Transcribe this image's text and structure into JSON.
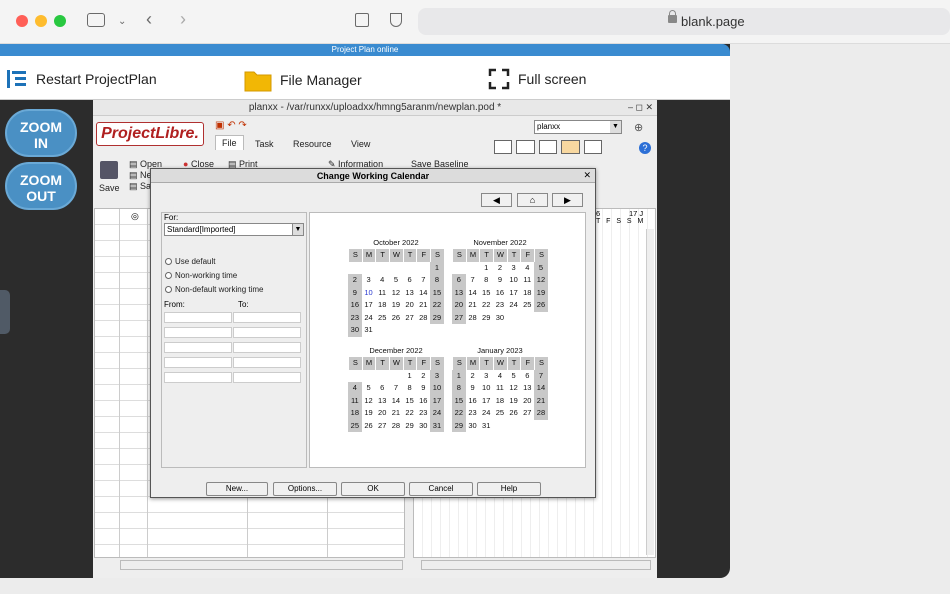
{
  "browser": {
    "url": "blank.page"
  },
  "top_strip": {
    "title": "Project Plan online"
  },
  "toolbar": {
    "restart_label": "Restart ProjectPlan",
    "file_manager_label": "File Manager",
    "full_screen_label": "Full screen"
  },
  "zoom": {
    "in_line1": "ZOOM",
    "in_line2": "IN",
    "out_line1": "ZOOM",
    "out_line2": "OUT"
  },
  "app": {
    "title": "planxx - /var/runxx/uploadxx/hmng5aranm/newplan.pod *",
    "logo": "ProjectLibre.",
    "menu": [
      "File",
      "Task",
      "Resource",
      "View"
    ],
    "project_select": "planxx",
    "ribbon": {
      "save": "Save",
      "open": "Open",
      "close": "Close",
      "print": "Print",
      "information": "Information",
      "save_baseline": "Save Baseline",
      "new_abbr": "Ne",
      "sa_abbr": "Sa"
    },
    "gantt_header": {
      "day_a": "6",
      "day_b": "17 J",
      "letters": "T F S S M"
    }
  },
  "dialog": {
    "title": "Change Working Calendar",
    "for_label": "For:",
    "for_value": "Standard[Imported]",
    "radios": [
      "Use default",
      "Non-working time",
      "Non-default working time"
    ],
    "from_label": "From:",
    "to_label": "To:",
    "buttons": {
      "new": "New...",
      "options": "Options...",
      "ok": "OK",
      "cancel": "Cancel",
      "help": "Help"
    },
    "weekdays": [
      "S",
      "M",
      "T",
      "W",
      "T",
      "F",
      "S"
    ],
    "months": [
      {
        "name": "October 2022",
        "start": 6,
        "days": 31
      },
      {
        "name": "November 2022",
        "start": 2,
        "days": 30
      },
      {
        "name": "December 2022",
        "start": 4,
        "days": 31
      },
      {
        "name": "January 2023",
        "start": 0,
        "days": 31
      }
    ],
    "highlighted_day": {
      "month": "October 2022",
      "day": 10
    }
  }
}
